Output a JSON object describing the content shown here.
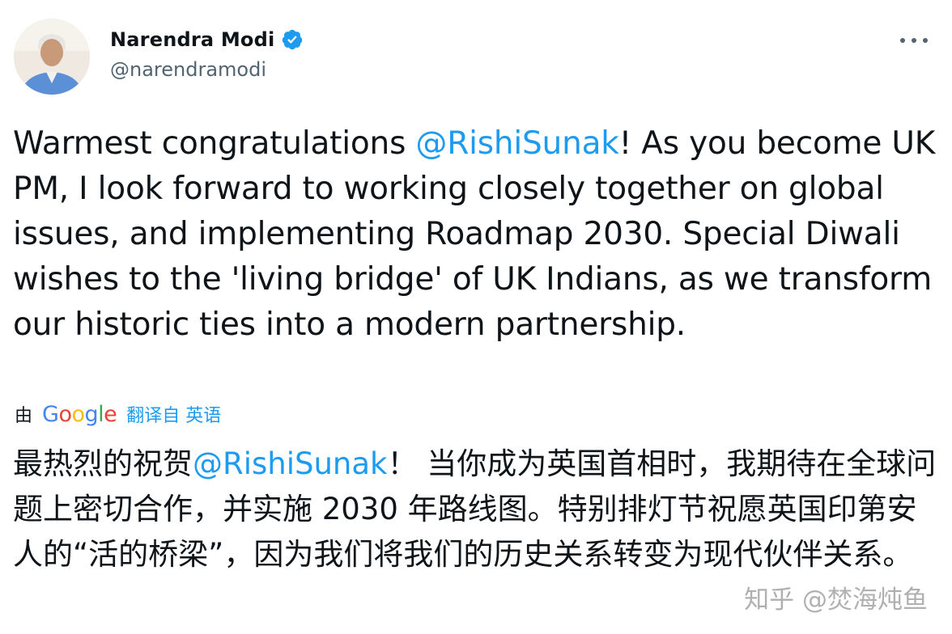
{
  "author": {
    "display_name": "Narendra Modi",
    "handle": "@narendramodi",
    "verified": true
  },
  "tweet": {
    "text_parts": [
      "Warmest congratulations ",
      "@RishiSunak",
      "! As you become UK PM, I look forward to working closely together on global issues, and implementing Roadmap 2030. Special Diwali wishes to the 'living bridge' of UK Indians, as we transform our historic ties into a modern partnership."
    ]
  },
  "translation": {
    "by_label": "由",
    "provider_letters": [
      "G",
      "o",
      "o",
      "g",
      "l",
      "e"
    ],
    "translated_from": "翻译自 英语",
    "text_parts": [
      "最热烈的祝贺",
      "@RishiSunak",
      "！ 当你成为英国首相时，我期待在全球问题上密切合作，并实施 2030 年路线图。特别排灯节祝愿英国印第安人的“活的桥梁”，因为我们将我们的历史关系转变为现代伙伴关系。"
    ]
  },
  "watermark": "知乎 @焚海炖鱼",
  "colors": {
    "link": "#1d9bf0",
    "text": "#0f1419",
    "secondary": "#536471",
    "verified": "#1d9bf0"
  },
  "icons": {
    "verified": "verified-badge-icon",
    "more": "more-options-icon"
  }
}
